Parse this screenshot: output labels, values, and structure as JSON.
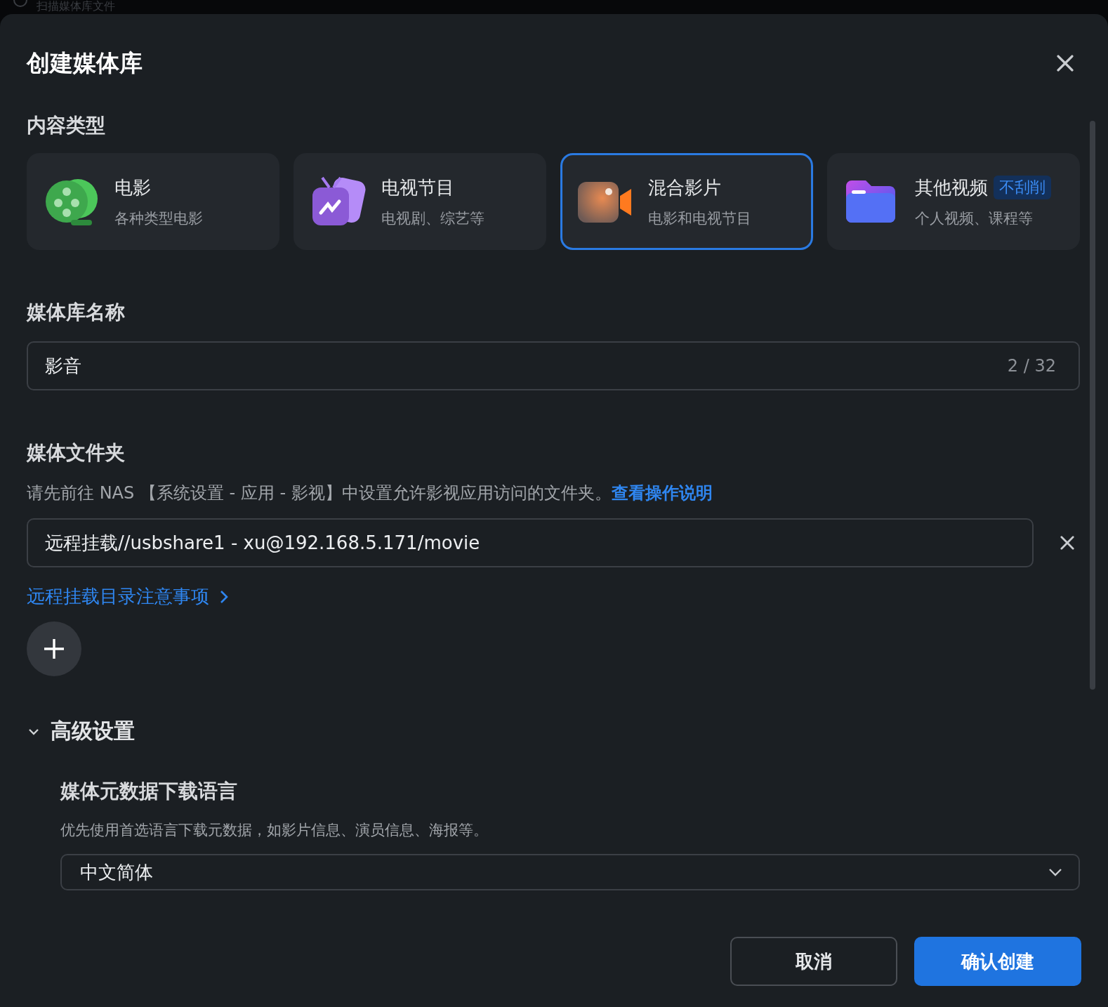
{
  "background": {
    "task": "扫描媒体库文件"
  },
  "dialog": {
    "title": "创建媒体库"
  },
  "content_type": {
    "label": "内容类型",
    "options": [
      {
        "title": "电影",
        "subtitle": "各种类型电影",
        "selected": false
      },
      {
        "title": "电视节目",
        "subtitle": "电视剧、综艺等",
        "selected": false
      },
      {
        "title": "混合影片",
        "subtitle": "电影和电视节目",
        "selected": true
      },
      {
        "title": "其他视频",
        "badge": "不刮削",
        "subtitle": "个人视频、课程等",
        "selected": false
      }
    ]
  },
  "library_name": {
    "label": "媒体库名称",
    "value": "影音",
    "counter": "2 / 32"
  },
  "media_folder": {
    "label": "媒体文件夹",
    "description": "请先前往 NAS 【系统设置 - 应用 - 影视】中设置允许影视应用访问的文件夹。",
    "help_link": "查看操作说明",
    "folders": [
      "远程挂载//usbshare1 - xu@192.168.5.171/movie"
    ],
    "remote_note_link": "远程挂载目录注意事项"
  },
  "advanced": {
    "label": "高级设置",
    "expanded": true,
    "metadata_language": {
      "label": "媒体元数据下载语言",
      "description": "优先使用首选语言下载元数据，如影片信息、演员信息、海报等。",
      "value": "中文简体"
    }
  },
  "buttons": [
    {
      "label": "取消",
      "kind": "secondary"
    },
    {
      "label": "确认创建",
      "kind": "primary"
    }
  ]
}
